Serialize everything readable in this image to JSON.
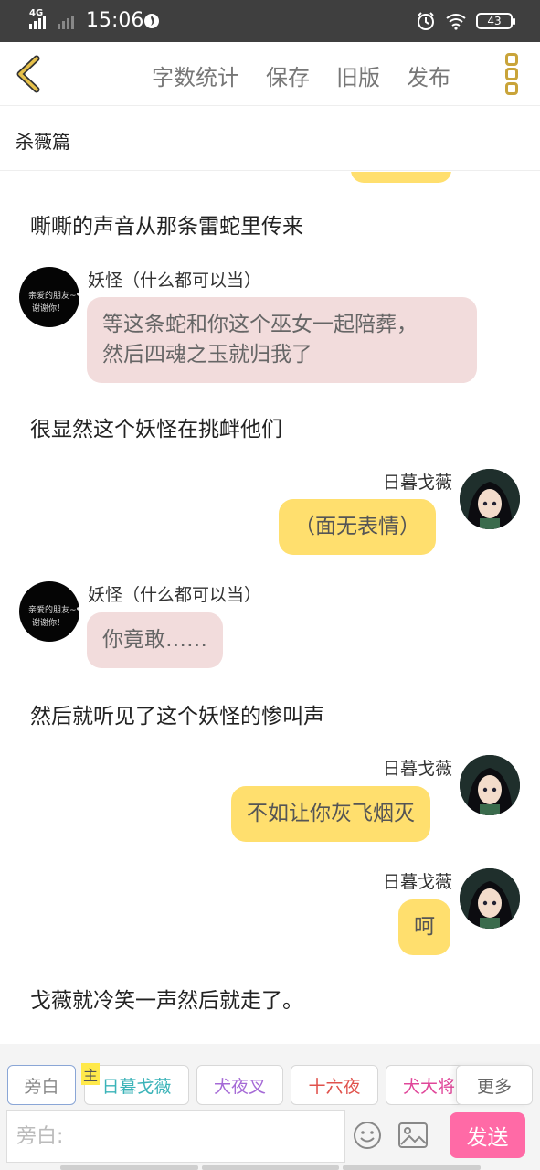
{
  "status_bar": {
    "network": "4G",
    "time": "15:06",
    "battery": "43"
  },
  "toolbar": {
    "word_count_label": "字数统计",
    "save_label": "保存",
    "old_version_label": "旧版",
    "publish_label": "发布"
  },
  "chapter_title": "杀薇篇",
  "messages": [
    {
      "type": "narration",
      "text": "嘶嘶的声音从那条雷蛇里传来"
    },
    {
      "type": "left",
      "name": "妖怪（什么都可以当）",
      "text_line1": "等这条蛇和你这个巫女一起陪葬，",
      "text_line2": "然后四魂之玉就归我了",
      "avatar_text1": "亲爱的朋友~❤",
      "avatar_text2": "谢谢你！"
    },
    {
      "type": "narration",
      "text": "很显然这个妖怪在挑衅他们"
    },
    {
      "type": "right",
      "name": "日暮戈薇",
      "text": "（面无表情）"
    },
    {
      "type": "left",
      "name": "妖怪（什么都可以当）",
      "text": "你竟敢……",
      "avatar_text1": "亲爱的朋友~❤",
      "avatar_text2": "谢谢你！"
    },
    {
      "type": "narration",
      "text": "然后就听见了这个妖怪的惨叫声"
    },
    {
      "type": "right",
      "name": "日暮戈薇",
      "text": "不如让你灰飞烟灭"
    },
    {
      "type": "right",
      "name": "日暮戈薇",
      "text": "呵"
    },
    {
      "type": "narration",
      "text": "戈薇就冷笑一声然后就走了。"
    }
  ],
  "roles": [
    {
      "label": "旁白",
      "color": "#999999"
    },
    {
      "label": "日暮戈薇",
      "color": "#3ab3b8"
    },
    {
      "label": "犬夜叉",
      "color": "#a56ad6"
    },
    {
      "label": "十六夜",
      "color": "#e0524c"
    },
    {
      "label": "犬大将",
      "color": "#e0479a"
    }
  ],
  "main_badge": "主",
  "more_label": "更多",
  "input": {
    "placeholder": "旁白:",
    "value": ""
  },
  "send_label": "发送",
  "colors": {
    "accent_yellow": "#ffdf6e",
    "pink_bubble": "#f2dcdc",
    "send_pink": "#ff6aa6",
    "icon_gold": "#c9a43a"
  }
}
